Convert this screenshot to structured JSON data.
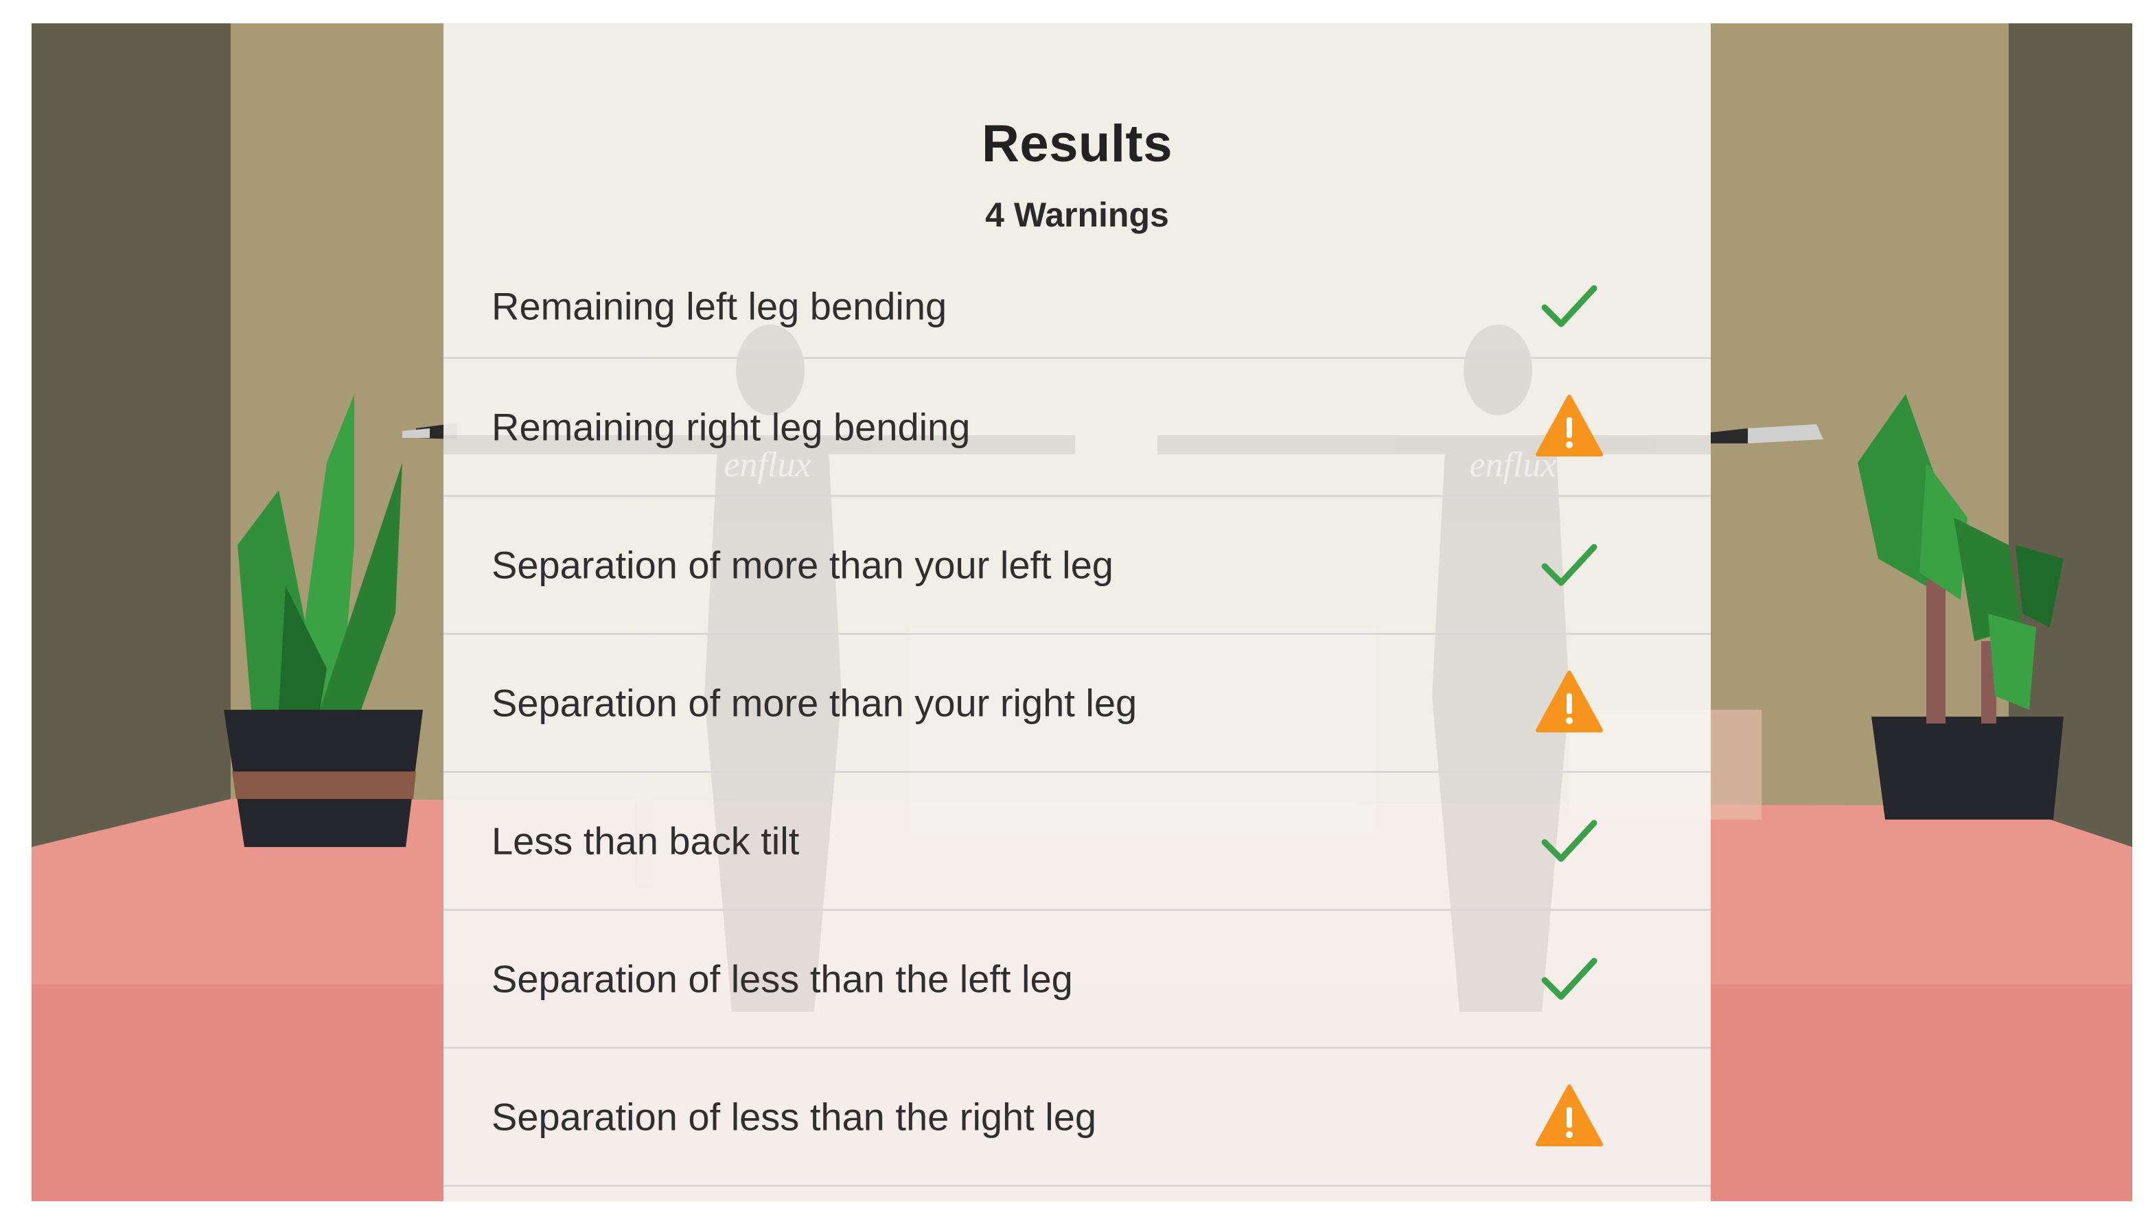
{
  "results": {
    "title": "Results",
    "subtitle": "4 Warnings",
    "items": [
      {
        "label": "Remaining left leg bending",
        "status": "ok"
      },
      {
        "label": "Remaining right leg bending",
        "status": "warning"
      },
      {
        "label": "Separation of more than your left leg",
        "status": "ok"
      },
      {
        "label": "Separation of more than your right leg",
        "status": "warning"
      },
      {
        "label": "Less than back tilt",
        "status": "ok"
      },
      {
        "label": "Separation of less than the left leg",
        "status": "ok"
      },
      {
        "label": "Separation of less than the right leg",
        "status": "warning"
      }
    ]
  },
  "scene": {
    "watermark": "enflux"
  },
  "colors": {
    "ok": "#3aa14a",
    "warning": "#f7941d",
    "floor": "#e9978c",
    "wall": "#a99a76"
  },
  "icons": {
    "ok": "check-icon",
    "warning": "warning-triangle-icon"
  }
}
